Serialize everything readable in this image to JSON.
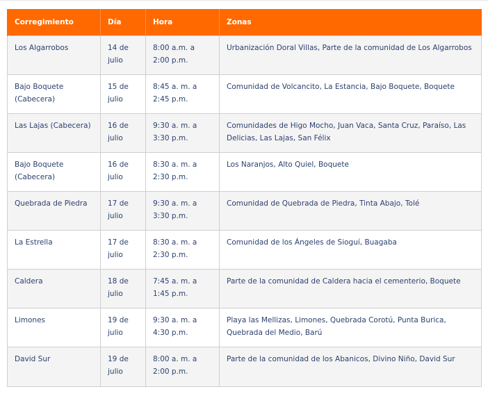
{
  "table": {
    "headers": [
      "Corregimiento",
      "Día",
      "Hora",
      "Zonas"
    ],
    "rows": [
      {
        "corregimiento": "Los Algarrobos",
        "dia": "14 de julio",
        "hora": "8:00 a.m. a 2:00 p.m.",
        "zonas": "Urbanización Doral Villas, Parte de la comunidad de Los Algarrobos"
      },
      {
        "corregimiento": "Bajo Boquete (Cabecera)",
        "dia": "15 de julio",
        "hora": "8:45 a. m. a 2:45 p.m.",
        "zonas": "Comunidad de Volcancito, La Estancia, Bajo Boquete, Boquete"
      },
      {
        "corregimiento": "Las Lajas (Cabecera)",
        "dia": "16 de julio",
        "hora": "9:30 a. m. a 3:30 p.m.",
        "zonas": "Comunidades de Higo Mocho, Juan Vaca, Santa Cruz, Paraíso, Las Delicias, Las Lajas, San Félix"
      },
      {
        "corregimiento": "Bajo Boquete (Cabecera)",
        "dia": "16 de julio",
        "hora": "8:30 a. m. a 2:30 p.m.",
        "zonas": "Los Naranjos, Alto Quiel, Boquete"
      },
      {
        "corregimiento": "Quebrada de Piedra",
        "dia": "17 de julio",
        "hora": "9:30 a. m. a 3:30 p.m.",
        "zonas": "Comunidad de Quebrada de Piedra, Tinta Abajo, Tolé"
      },
      {
        "corregimiento": "La Estrella",
        "dia": "17 de julio",
        "hora": "8:30 a. m. a 2:30 p.m.",
        "zonas": "Comunidad de los Ángeles de Sioguí, Buagaba"
      },
      {
        "corregimiento": "Caldera",
        "dia": "18 de julio",
        "hora": "7:45 a. m. a 1:45 p.m.",
        "zonas": "Parte de la comunidad de Caldera hacia el cementerio, Boquete"
      },
      {
        "corregimiento": "Limones",
        "dia": "19 de julio",
        "hora": "9:30 a. m. a 4:30 p.m.",
        "zonas": "Playa las Mellizas, Limones, Quebrada Corotú, Punta Burica, Quebrada del Medio, Barú"
      },
      {
        "corregimiento": "David Sur",
        "dia": "19 de julio",
        "hora": "8:00 a. m. a 2:00 p.m.",
        "zonas": "Parte de la comunidad de los Abanicos, Divino Niño, David Sur"
      }
    ]
  }
}
